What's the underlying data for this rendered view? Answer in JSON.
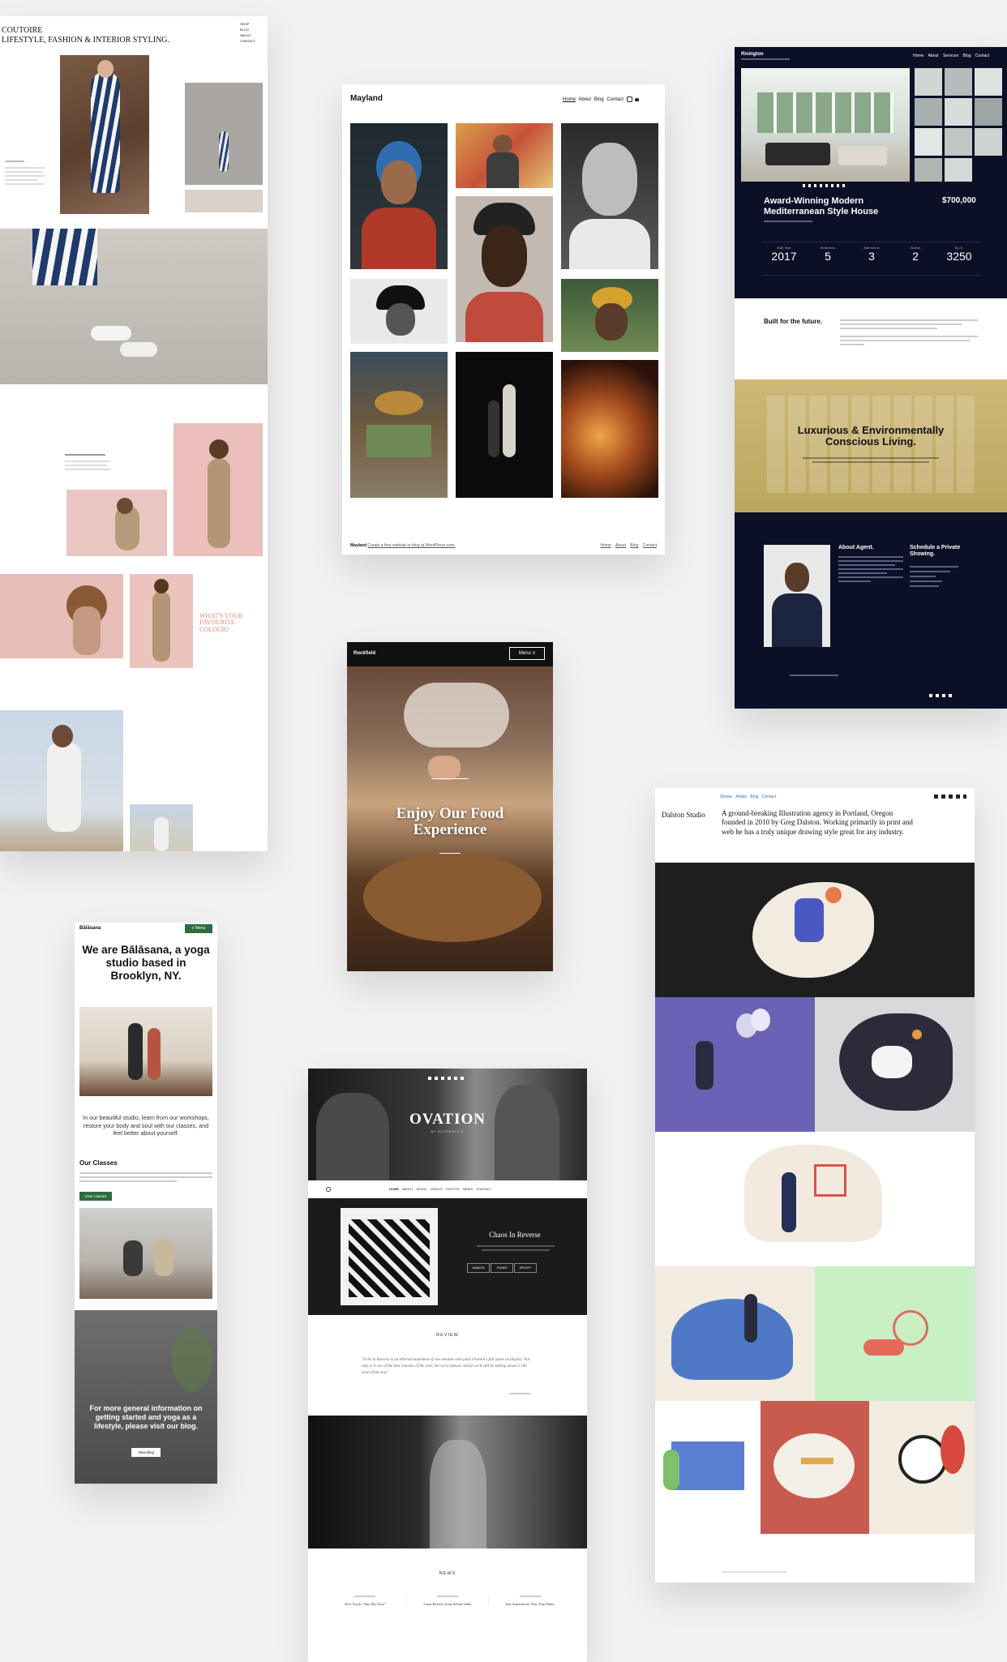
{
  "coutoire": {
    "title_line1": "COUTOIRE",
    "title_line2": "LIFESTYLE, FASHION & INTERIOR STYLING.",
    "nav": [
      "SHOP",
      "BLOG",
      "ABOUT",
      "CONTACT"
    ],
    "pullquote": "WHAT'S YOUR FAVOURITE COLOUR?"
  },
  "mayland": {
    "brand": "Mayland",
    "nav": [
      "Home",
      "About",
      "Blog",
      "Contact"
    ],
    "footer_brand": "Mayland",
    "footer_link": "Create a free website or blog at WordPress.com.",
    "footer_nav": [
      "Home",
      "About",
      "Blog",
      "Contact"
    ]
  },
  "rivington": {
    "brand": "Rivington",
    "nav": [
      "Home",
      "About",
      "Services",
      "Blog",
      "Contact"
    ],
    "listing_title": "Award-Winning Modern Mediterranean Style House",
    "price": "$700,000",
    "stats": [
      {
        "label": "Built Year",
        "value": "2017"
      },
      {
        "label": "Bedrooms",
        "value": "5"
      },
      {
        "label": "Bathrooms",
        "value": "3"
      },
      {
        "label": "Stories",
        "value": "2"
      },
      {
        "label": "Sq. ft.",
        "value": "3250"
      }
    ],
    "built_heading": "Built for the future.",
    "luxury_heading": "Luxurious & Environmentally Conscious Living.",
    "agent_heading": "About Agent.",
    "schedule_heading": "Schedule a Private Showing."
  },
  "rockfield": {
    "brand": "Rockfield",
    "menu_label": "Menu",
    "hero_title": "Enjoy Our Food Experience"
  },
  "dalston": {
    "nav": [
      "Shows",
      "Artists",
      "Blog",
      "Contact"
    ],
    "brand": "Dalston Studio",
    "intro": "A ground-breaking Illustration agency in Portland, Oregon founded in 2010 by Greg Dalston. Working primarily in print and web he has a truly unique drawing style great for any industry."
  },
  "balasana": {
    "brand": "Bālāsana",
    "menu_label": "Menu",
    "headline": "We are Bālāsana, a yoga studio based in Brooklyn, NY.",
    "intro": "In our beautiful studio, learn from our workshops, restore your body and soul with our classes, and feel better about yourself.",
    "classes_heading": "Our Classes",
    "classes_button": "View Classes",
    "blog_text": "For more general information on getting started and yoga as a lifestyle, please visit our blog.",
    "blog_button": "View Blog"
  },
  "ovation": {
    "title": "OVATION",
    "subtitle": "BY AUTOMATTIC",
    "nav": [
      "HOME",
      "ABOUT",
      "MUSIC",
      "VIDEOS",
      "PHOTOS",
      "NEWS",
      "CONTACT"
    ],
    "album_title": "Chaos In Reverse",
    "buttons": [
      "AMAZON",
      "ITUNES",
      "SPOTIFY"
    ],
    "review_heading": "REVIEW",
    "review_quote": "\"Echo in Reverse is an ethereal statement of raw emotion that pulls Ovation's full talent on display. Not only is it one of the best releases of the year, but we're almost certain we'll still be talking about it 100 years from now.\"",
    "news_heading": "NEWS",
    "news": [
      "New Track: \"Into My Own\"",
      "Great Review from InTune Indie",
      "Just Announced: New Tour Dates"
    ]
  },
  "colors": {
    "background": "#f1f1f1",
    "navy": "#0b1027",
    "gold": "#c8b26a",
    "green": "#2e6b3e",
    "coral": "#e0867a",
    "dalston_purple": "#6b62b5",
    "dalston_green": "#c8f0c4",
    "dalston_red": "#c85a4f"
  }
}
